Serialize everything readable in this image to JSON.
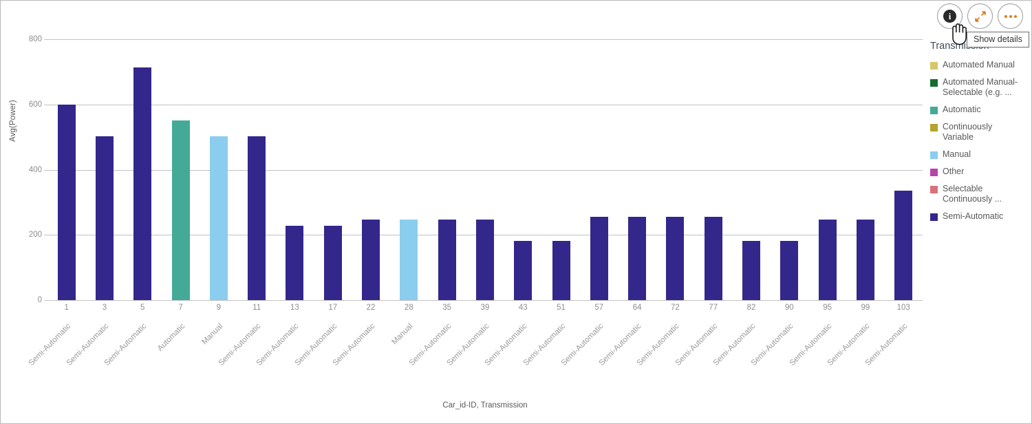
{
  "toolbar": {
    "info_label": "i",
    "info_name": "show-details-icon",
    "expand_name": "fullscreen-icon",
    "more_name": "more-options-icon",
    "tooltip": "Show details"
  },
  "legend": {
    "title": "Transmission",
    "items": [
      {
        "label": "Automated Manual",
        "color": "#d6c86a"
      },
      {
        "label": "Automated Manual-Selectable (e.g. ...",
        "color": "#146d2e"
      },
      {
        "label": "Automatic",
        "color": "#44aa97"
      },
      {
        "label": "Continuously Variable",
        "color": "#b3a52c"
      },
      {
        "label": "Manual",
        "color": "#8bcdee"
      },
      {
        "label": "Other",
        "color": "#b545a8"
      },
      {
        "label": "Selectable Continuously ...",
        "color": "#d9717a"
      },
      {
        "label": "Semi-Automatic",
        "color": "#33278c"
      }
    ]
  },
  "chart_data": {
    "type": "bar",
    "title": "",
    "xlabel": "Car_id-ID, Transmission",
    "ylabel": "Avg(Power)",
    "ylim": [
      0,
      800
    ],
    "yticks": [
      0,
      200,
      400,
      600,
      800
    ],
    "grid": true,
    "legend_position": "right",
    "categories": [
      "1",
      "3",
      "5",
      "7",
      "9",
      "11",
      "13",
      "17",
      "22",
      "28",
      "35",
      "39",
      "43",
      "51",
      "57",
      "64",
      "72",
      "77",
      "82",
      "90",
      "95",
      "99",
      "103"
    ],
    "sub_categories": [
      "Semi-Automatic",
      "Semi-Automatic",
      "Semi-Automatic",
      "Automatic",
      "Manual",
      "Semi-Automatic",
      "Semi-Automatic",
      "Semi-Automatic",
      "Semi-Automatic",
      "Manual",
      "Semi-Automatic",
      "Semi-Automatic",
      "Semi-Automatic",
      "Semi-Automatic",
      "Semi-Automatic",
      "Semi-Automatic",
      "Semi-Automatic",
      "Semi-Automatic",
      "Semi-Automatic",
      "Semi-Automatic",
      "Semi-Automatic",
      "Semi-Automatic",
      "Semi-Automatic"
    ],
    "values": [
      600,
      503,
      713,
      550,
      503,
      503,
      228,
      228,
      248,
      248,
      248,
      248,
      182,
      182,
      255,
      255,
      255,
      255,
      182,
      182,
      248,
      248,
      335
    ],
    "colors": [
      "#33278c",
      "#33278c",
      "#33278c",
      "#44aa97",
      "#8bcdee",
      "#33278c",
      "#33278c",
      "#33278c",
      "#33278c",
      "#8bcdee",
      "#33278c",
      "#33278c",
      "#33278c",
      "#33278c",
      "#33278c",
      "#33278c",
      "#33278c",
      "#33278c",
      "#33278c",
      "#33278c",
      "#33278c",
      "#33278c",
      "#33278c"
    ]
  }
}
